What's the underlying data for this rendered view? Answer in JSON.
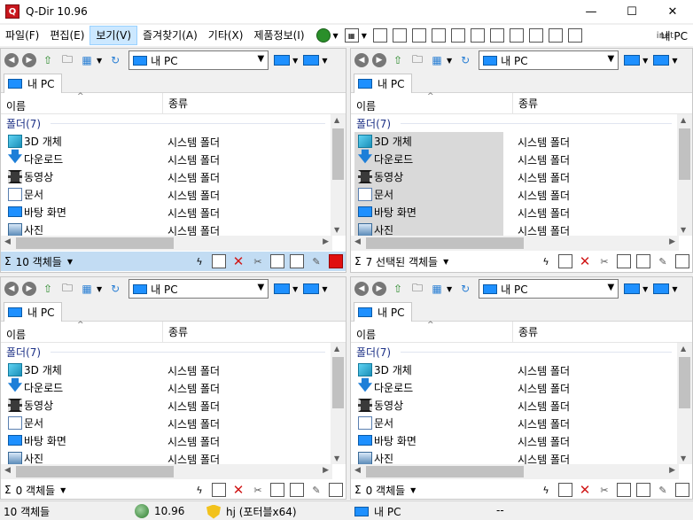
{
  "window": {
    "title": "Q-Dir 10.96",
    "app_icon": "Q",
    "minimize": "—",
    "maximize": "☐",
    "close": "✕"
  },
  "menu": {
    "items": [
      "파일(F)",
      "편집(E)",
      "보기(V)",
      "즐겨찾기(A)",
      "기타(X)",
      "제품정보(I)"
    ],
    "active_index": 2,
    "inet_label": "inet",
    "tail_label": "내 PC"
  },
  "panes": [
    {
      "address": "내 PC",
      "tab_label": "내 PC",
      "col_name": "이름",
      "col_type": "종류",
      "group_label": "폴더(7)",
      "rows": [
        {
          "name": "3D 개체",
          "type": "시스템 폴더",
          "icon": "cube-icon",
          "selected": false
        },
        {
          "name": "다운로드",
          "type": "시스템 폴더",
          "icon": "download-icon",
          "selected": false
        },
        {
          "name": "동영상",
          "type": "시스템 폴더",
          "icon": "video-icon",
          "selected": false
        },
        {
          "name": "문서",
          "type": "시스템 폴더",
          "icon": "document-icon",
          "selected": false
        },
        {
          "name": "바탕 화면",
          "type": "시스템 폴더",
          "icon": "desktop-icon",
          "selected": false
        },
        {
          "name": "사진",
          "type": "시스템 폴더",
          "icon": "pictures-icon",
          "selected": false
        }
      ],
      "status_sigma": "Σ",
      "status_count": "10 객체들",
      "status_active": true
    },
    {
      "address": "내 PC",
      "tab_label": "내 PC",
      "col_name": "이름",
      "col_type": "종류",
      "group_label": "폴더(7)",
      "rows": [
        {
          "name": "3D 개체",
          "type": "시스템 폴더",
          "icon": "cube-icon",
          "selected": true
        },
        {
          "name": "다운로드",
          "type": "시스템 폴더",
          "icon": "download-icon",
          "selected": true
        },
        {
          "name": "동영상",
          "type": "시스템 폴더",
          "icon": "video-icon",
          "selected": true
        },
        {
          "name": "문서",
          "type": "시스템 폴더",
          "icon": "document-icon",
          "selected": true
        },
        {
          "name": "바탕 화면",
          "type": "시스템 폴더",
          "icon": "desktop-icon",
          "selected": true
        },
        {
          "name": "사진",
          "type": "시스템 폴더",
          "icon": "pictures-icon",
          "selected": true
        }
      ],
      "status_sigma": "Σ",
      "status_count": "7 선택된 객체들",
      "status_active": false
    },
    {
      "address": "내 PC",
      "tab_label": "내 PC",
      "col_name": "이름",
      "col_type": "종류",
      "group_label": "폴더(7)",
      "rows": [
        {
          "name": "3D 개체",
          "type": "시스템 폴더",
          "icon": "cube-icon",
          "selected": false
        },
        {
          "name": "다운로드",
          "type": "시스템 폴더",
          "icon": "download-icon",
          "selected": false
        },
        {
          "name": "동영상",
          "type": "시스템 폴더",
          "icon": "video-icon",
          "selected": false
        },
        {
          "name": "문서",
          "type": "시스템 폴더",
          "icon": "document-icon",
          "selected": false
        },
        {
          "name": "바탕 화면",
          "type": "시스템 폴더",
          "icon": "desktop-icon",
          "selected": false
        },
        {
          "name": "사진",
          "type": "시스템 폴더",
          "icon": "pictures-icon",
          "selected": false
        }
      ],
      "status_sigma": "Σ",
      "status_count": "0 객체들",
      "status_active": false
    },
    {
      "address": "내 PC",
      "tab_label": "내 PC",
      "col_name": "이름",
      "col_type": "종류",
      "group_label": "폴더(7)",
      "rows": [
        {
          "name": "3D 개체",
          "type": "시스템 폴더",
          "icon": "cube-icon",
          "selected": false
        },
        {
          "name": "다운로드",
          "type": "시스템 폴더",
          "icon": "download-icon",
          "selected": false
        },
        {
          "name": "동영상",
          "type": "시스템 폴더",
          "icon": "video-icon",
          "selected": false
        },
        {
          "name": "문서",
          "type": "시스템 폴더",
          "icon": "document-icon",
          "selected": false
        },
        {
          "name": "바탕 화면",
          "type": "시스템 폴더",
          "icon": "desktop-icon",
          "selected": false
        },
        {
          "name": "사진",
          "type": "시스템 폴더",
          "icon": "pictures-icon",
          "selected": false
        }
      ],
      "status_sigma": "Σ",
      "status_count": "0 객체들",
      "status_active": false
    }
  ],
  "bottom_status": {
    "count": "10 객체들",
    "version": "10.96",
    "portable": "hj (포터블x64)",
    "location": "내 PC",
    "extra": "--"
  },
  "colors": {
    "active_status": "#c2dcf3",
    "selection": "#d9d9d9",
    "group_text": "#1e3287"
  }
}
